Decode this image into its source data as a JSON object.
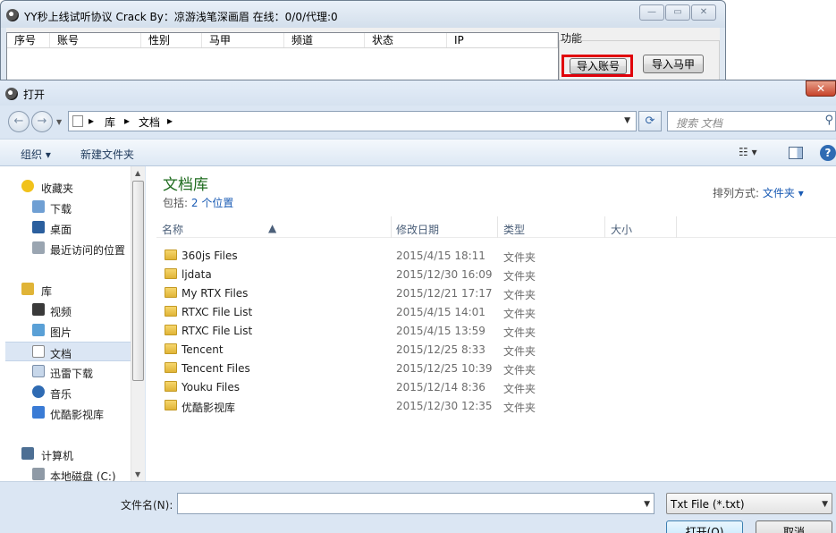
{
  "bg_window": {
    "title": "YY秒上线试听协议 Crack By：凉游浅笔深画眉 在线：0/0/代理:0",
    "columns": [
      "序号",
      "账号",
      "性别",
      "马甲",
      "频道",
      "状态",
      "IP"
    ],
    "function_label": "功能",
    "import_account_label": "导入账号",
    "import_vest_label": "导入马甲"
  },
  "dialog": {
    "title": "打开",
    "breadcrumb": [
      "库",
      "文档"
    ],
    "search_placeholder": "搜索 文档",
    "toolbar": {
      "organize": "组织 ▾",
      "new_folder": "新建文件夹"
    },
    "nav": {
      "favorites": "收藏夹",
      "downloads": "下载",
      "desktop": "桌面",
      "recent": "最近访问的位置",
      "libraries": "库",
      "videos": "视频",
      "pictures": "图片",
      "documents": "文档",
      "xunlei": "迅雷下载",
      "music": "音乐",
      "youku": "优酷影视库",
      "computer": "计算机",
      "local_disk": "本地磁盘 (C:)"
    },
    "library": {
      "title": "文档库",
      "includes_prefix": "包括:",
      "includes_link": "2 个位置",
      "arrange_label": "排列方式:",
      "arrange_value": "文件夹 ▾"
    },
    "columns": {
      "name": "名称",
      "modified": "修改日期",
      "type": "类型",
      "size": "大小"
    },
    "files": [
      {
        "name": "360js Files",
        "date": "2015/4/15 18:11",
        "type": "文件夹"
      },
      {
        "name": "ljdata",
        "date": "2015/12/30 16:09",
        "type": "文件夹"
      },
      {
        "name": "My RTX Files",
        "date": "2015/12/21 17:17",
        "type": "文件夹"
      },
      {
        "name": "RTXC File List",
        "date": "2015/4/15 14:01",
        "type": "文件夹"
      },
      {
        "name": "RTXC File List",
        "date": "2015/4/15 13:59",
        "type": "文件夹"
      },
      {
        "name": "Tencent",
        "date": "2015/12/25 8:33",
        "type": "文件夹"
      },
      {
        "name": "Tencent Files",
        "date": "2015/12/25 10:39",
        "type": "文件夹"
      },
      {
        "name": "Youku Files",
        "date": "2015/12/14 8:36",
        "type": "文件夹"
      },
      {
        "name": "优酷影视库",
        "date": "2015/12/30 12:35",
        "type": "文件夹"
      }
    ],
    "filename_label": "文件名(N):",
    "filename_value": "",
    "filetype_value": "Txt File (*.txt)",
    "open_label": "打开(O)",
    "cancel_label": "取消"
  }
}
